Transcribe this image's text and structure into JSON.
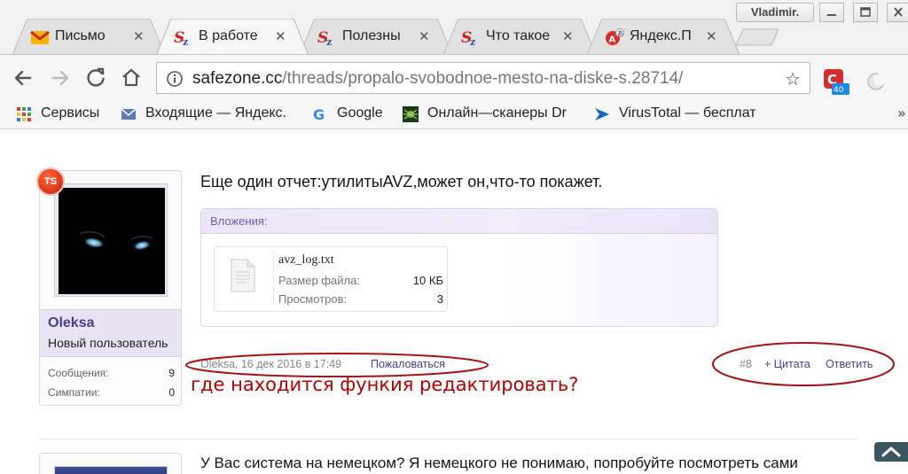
{
  "window": {
    "profile_name": "Vladimir."
  },
  "tabs": [
    {
      "title": "Письмо",
      "favicon": "mail-icon",
      "active": false
    },
    {
      "title": "В работе",
      "favicon": "safezone-icon",
      "active": true
    },
    {
      "title": "Полезны",
      "favicon": "safezone-icon",
      "active": false
    },
    {
      "title": "Что такое",
      "favicon": "safezone-icon",
      "active": false
    },
    {
      "title": "Яндекс.П",
      "favicon": "yandex-translate-icon",
      "active": false
    }
  ],
  "toolbar": {
    "url_host": "safezone.cc",
    "url_path": "/threads/propalo-svobodnoe-mesto-na-diske-s.28714/",
    "extension_badge": "40"
  },
  "bookmarks": [
    {
      "label": "Сервисы",
      "icon": "apps-grid-icon"
    },
    {
      "label": "Входящие — Яндекс.",
      "icon": "mail-icon"
    },
    {
      "label": "Google",
      "icon": "google-icon"
    },
    {
      "label": "Онлайн—сканеры Dr",
      "icon": "drweb-spider-icon"
    },
    {
      "label": "VirusTotal — бесплат",
      "icon": "virustotal-icon"
    }
  ],
  "post": {
    "ts_badge": "TS",
    "username": "Oleksa",
    "user_title": "Новый пользователь",
    "stats": [
      {
        "label": "Сообщения:",
        "value": "9"
      },
      {
        "label": "Симпатии:",
        "value": "0"
      }
    ],
    "message": "Еще один отчет:утилитыAVZ,может он,что-то покажет.",
    "attachments_label": "Вложения:",
    "file": {
      "name": "avz_log.txt",
      "rows": [
        {
          "label": "Размер файла:",
          "value": "10 КБ"
        },
        {
          "label": "Просмотров:",
          "value": "3"
        }
      ]
    },
    "meta": "Oleksa, 16 дек 2016 в 17:49",
    "report_label": "Пожаловаться",
    "post_number": "#8",
    "quote_label": "+ Цитата",
    "reply_label": "Ответить"
  },
  "annotation": {
    "text": "где находится функия редактировать?",
    "color": "#b30000"
  },
  "next_post": {
    "message": "У Вас система на немецком? Я немецкого не понимаю, попробуйте посмотреть сами"
  }
}
